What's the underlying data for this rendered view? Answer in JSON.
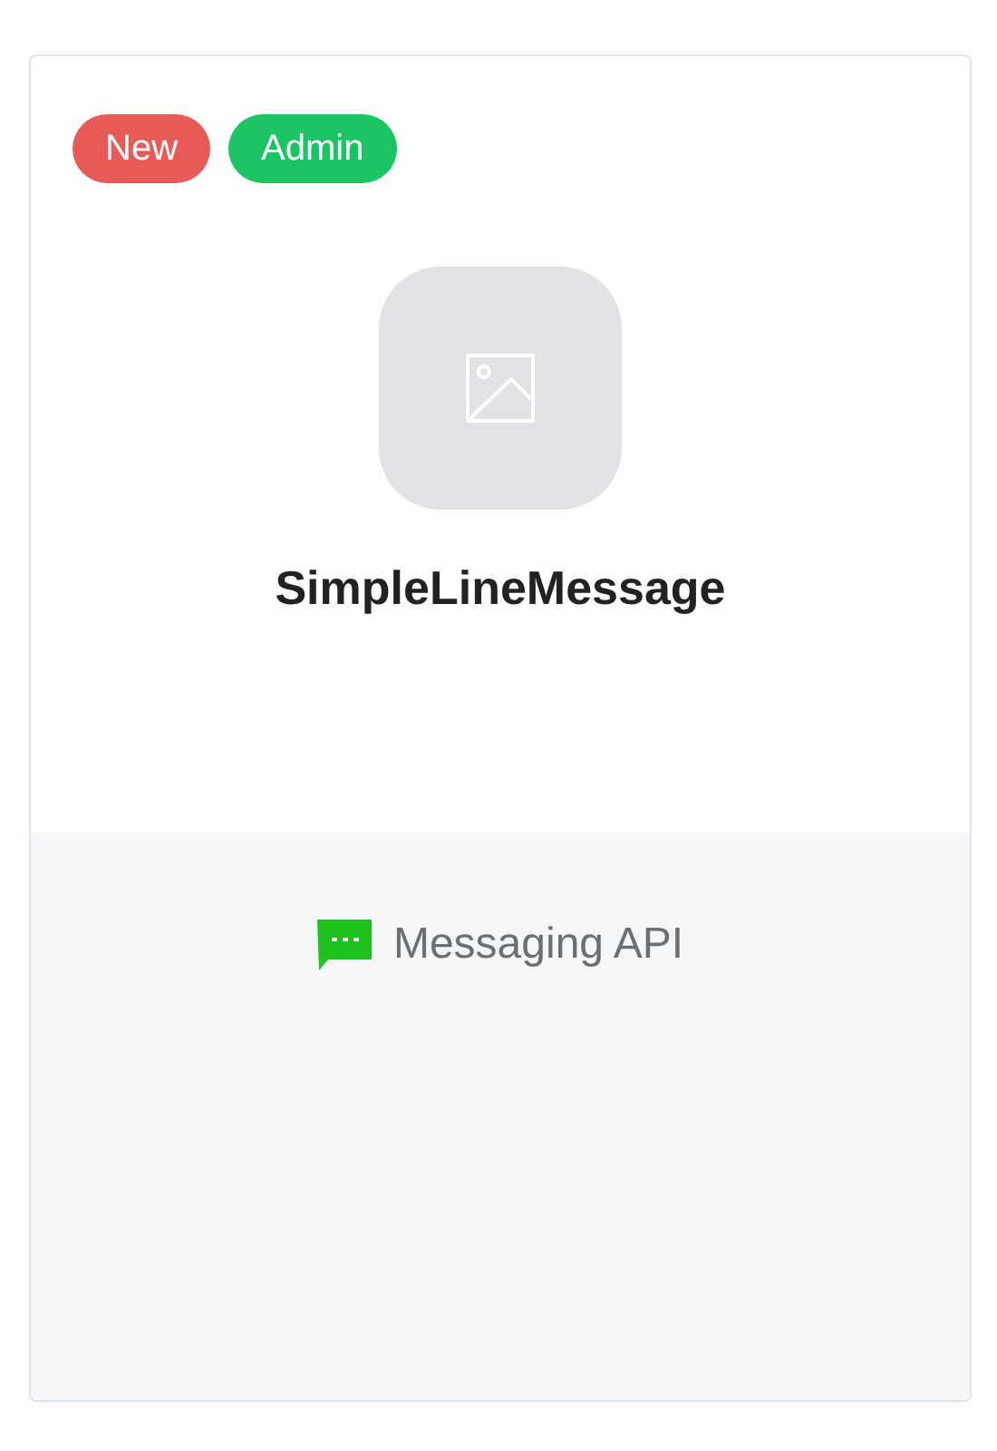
{
  "card": {
    "tags": [
      {
        "label": "New",
        "color": "#e85a57"
      },
      {
        "label": "Admin",
        "color": "#1ac463"
      }
    ],
    "title": "SimpleLineMessage",
    "feature": {
      "label": "Messaging API"
    }
  }
}
